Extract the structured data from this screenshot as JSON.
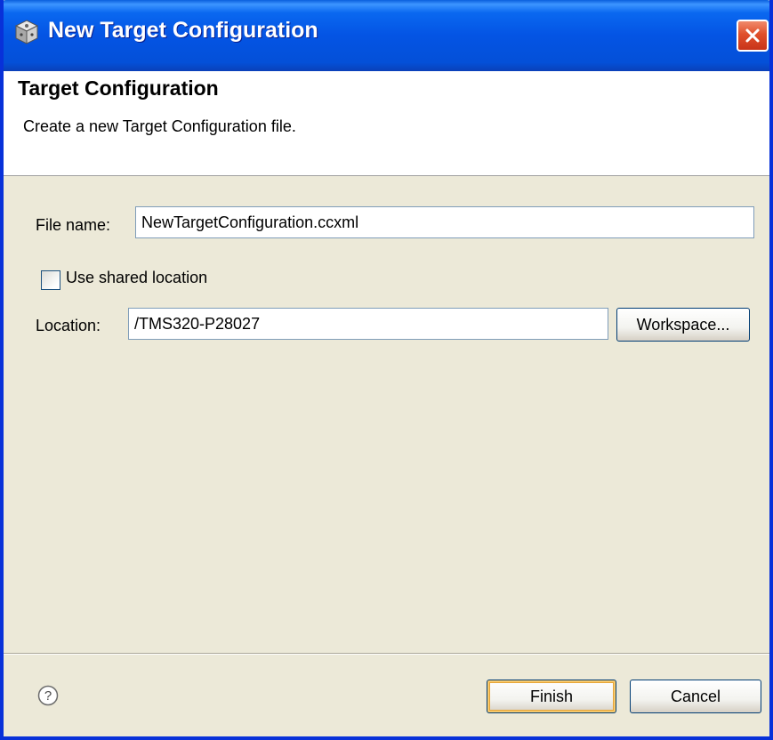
{
  "window": {
    "title": "New Target Configuration",
    "close_glyph": "✕"
  },
  "header": {
    "title": "Target Configuration",
    "description": "Create a new Target Configuration file."
  },
  "form": {
    "file_name_label": "File name:",
    "file_name_value": "NewTargetConfiguration.ccxml",
    "use_shared_label": "Use shared location",
    "use_shared_checked": false,
    "location_label": "Location:",
    "location_value": "/TMS320-P28027",
    "workspace_button": "Workspace..."
  },
  "footer": {
    "help_glyph": "?",
    "finish_button": "Finish",
    "cancel_button": "Cancel"
  },
  "colors": {
    "titlebar": "#0454e4",
    "dialog_bg": "#ece9d8",
    "close_button": "#e0502b",
    "default_button_focus": "#f7c96c"
  }
}
